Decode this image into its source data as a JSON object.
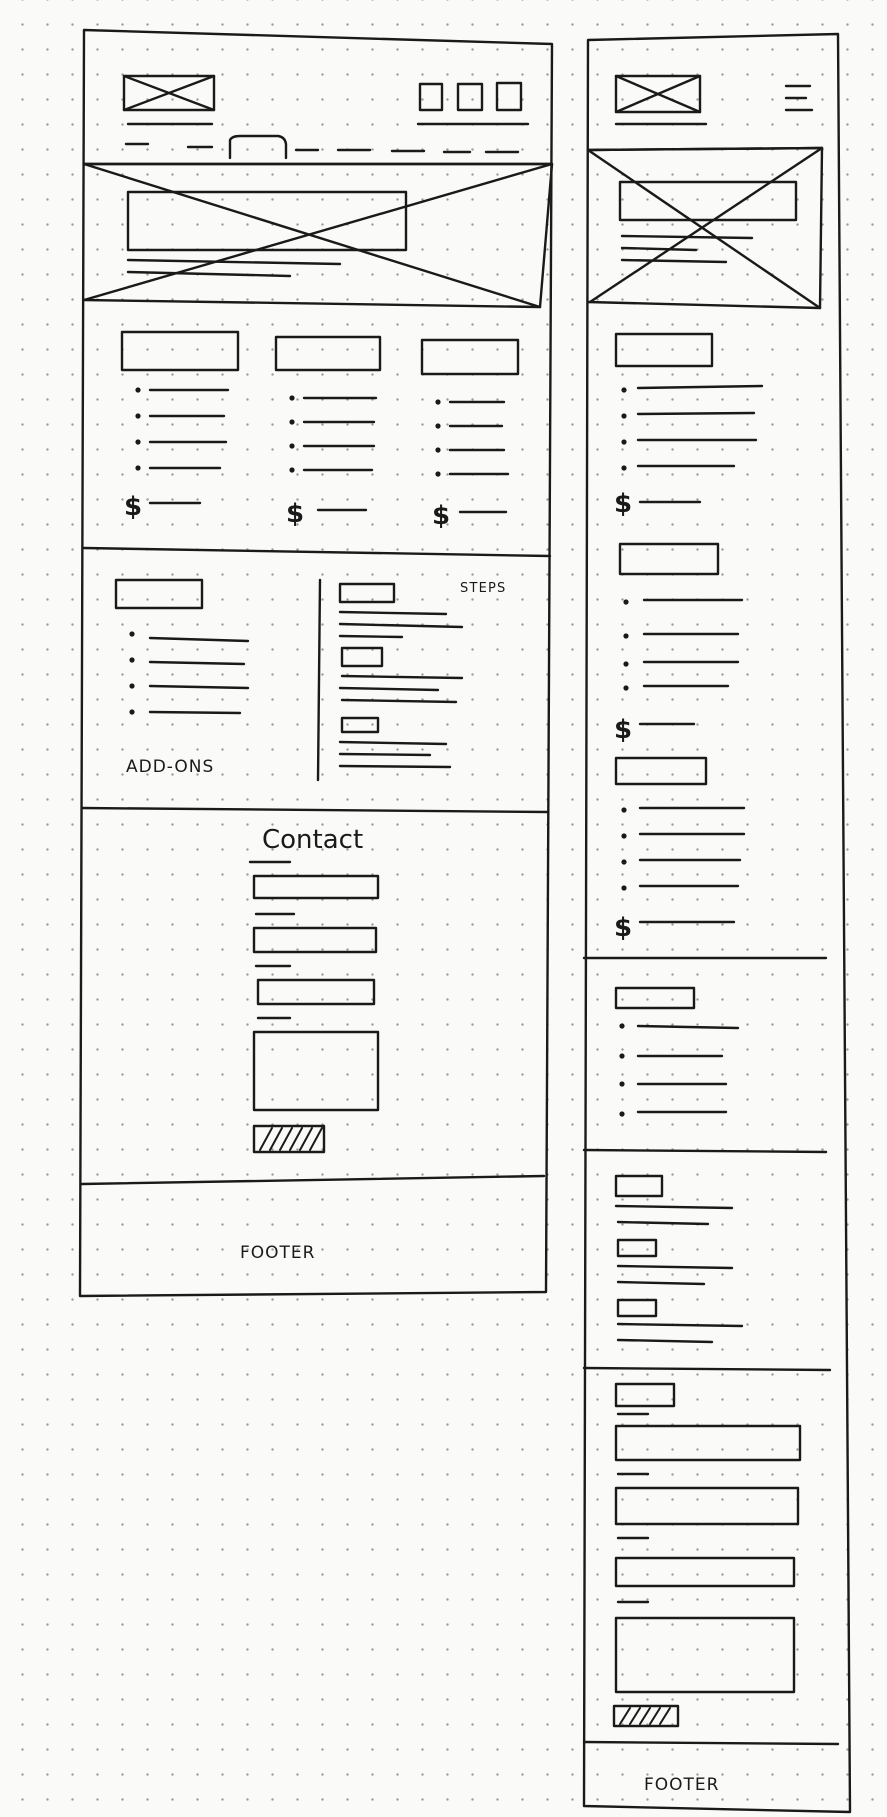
{
  "labels": {
    "steps": "STEPS",
    "addons": "ADD-ONS",
    "contact": "Contact",
    "footer_desktop": "FOOTER",
    "footer_mobile": "FOOTER",
    "currency": "$"
  },
  "icons": {
    "logo": "image-placeholder",
    "nav": "square-button",
    "mobile_menu": "hamburger-icon",
    "hero": "image-placeholder"
  }
}
